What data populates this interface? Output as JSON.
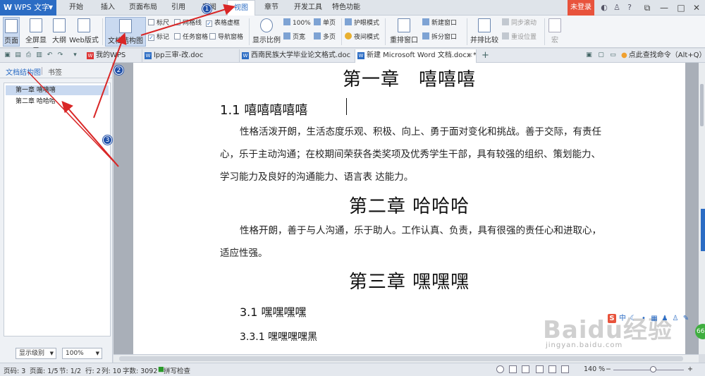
{
  "app": {
    "name": "WPS 文字"
  },
  "menu": {
    "items": [
      "开始",
      "插入",
      "页面布局",
      "引用",
      "审阅",
      "视图",
      "章节",
      "开发工具",
      "特色功能"
    ],
    "active": "视图",
    "login": "未登录"
  },
  "ribbon": {
    "page_view": "页面",
    "fullscreen": "全屏显示",
    "outline": "大纲",
    "web_layout": "Web版式",
    "doc_map": "文档结构图",
    "ruler": "标尺",
    "gridlines": "网格线",
    "table_gridlines": "表格虚框",
    "marks": "标记",
    "task_pane": "任务窗格",
    "nav_pane": "导航窗格",
    "zoom_ratio": "显示比例",
    "zoom_100": "100%",
    "page_width": "页宽",
    "single_page": "单页",
    "multi_page": "多页",
    "eye_mode": "护眼模式",
    "night_mode": "夜间模式",
    "arrange_all": "重排窗口",
    "new_window": "新建窗口",
    "split_window": "拆分窗口",
    "side_by_side": "并排比较",
    "sync_scroll": "同步滚动",
    "reset_position": "重设位置",
    "macro": "宏"
  },
  "tabs": [
    {
      "label": "我的WPS",
      "type": "wps"
    },
    {
      "label": "lpp三审-改.doc",
      "type": "w"
    },
    {
      "label": "西南民族大学毕业论文格式.doc",
      "type": "w"
    },
    {
      "label": "新建 Microsoft Word 文档.docx *",
      "type": "w"
    }
  ],
  "command_search": "点此查找命令（Alt+Q）",
  "sidebar": {
    "tabs": [
      "文档结构图",
      "书签"
    ],
    "items": [
      "第一章  嘻嘻嘻",
      "第二章  哈哈哈"
    ],
    "level_select": "显示级别",
    "zoom_select": "100%"
  },
  "document": {
    "ch1": "第一章　嘻嘻嘻",
    "sec1_1": "1.1  嘻嘻嘻嘻嘻",
    "p1_line1": "性格活泼开朗，生活态度乐观、积极、向上、勇于面对变化和挑战。善于交际，有责任",
    "p1_line2": "心，乐于主动沟通；在校期间荣获各类奖项及优秀学生干部，具有较强的组织、策划能力、",
    "p1_line3": "学习能力及良好的沟通能力、语言表  达能力。",
    "ch2": "第二章  哈哈哈",
    "p2_line1": "性格开朗，善于与人沟通，乐于助人。工作认真、负责，具有很强的责任心和进取心，",
    "p2_line2": "适应性强。",
    "ch3": "第三章  嘿嘿嘿",
    "sec3_1": "3.1  嘿嘿嘿嘿",
    "sec3_3_1": "3.3.1  嘿嘿嘿嘿黑"
  },
  "status": {
    "page": "页码: 3",
    "pages": "页面: 1/5",
    "section": "节: 1/2",
    "row": "行: 2",
    "col": "列: 10",
    "words": "字数: 3092",
    "spell": "拼写检查",
    "zoom": "140 %"
  },
  "annotations": {
    "badge1": "1",
    "badge2": "2",
    "badge3": "3",
    "arrow_color": "#d92626"
  },
  "watermark": {
    "brand": "Baidu经验",
    "url": "jingyan.baidu.com"
  },
  "float_badge": "66"
}
